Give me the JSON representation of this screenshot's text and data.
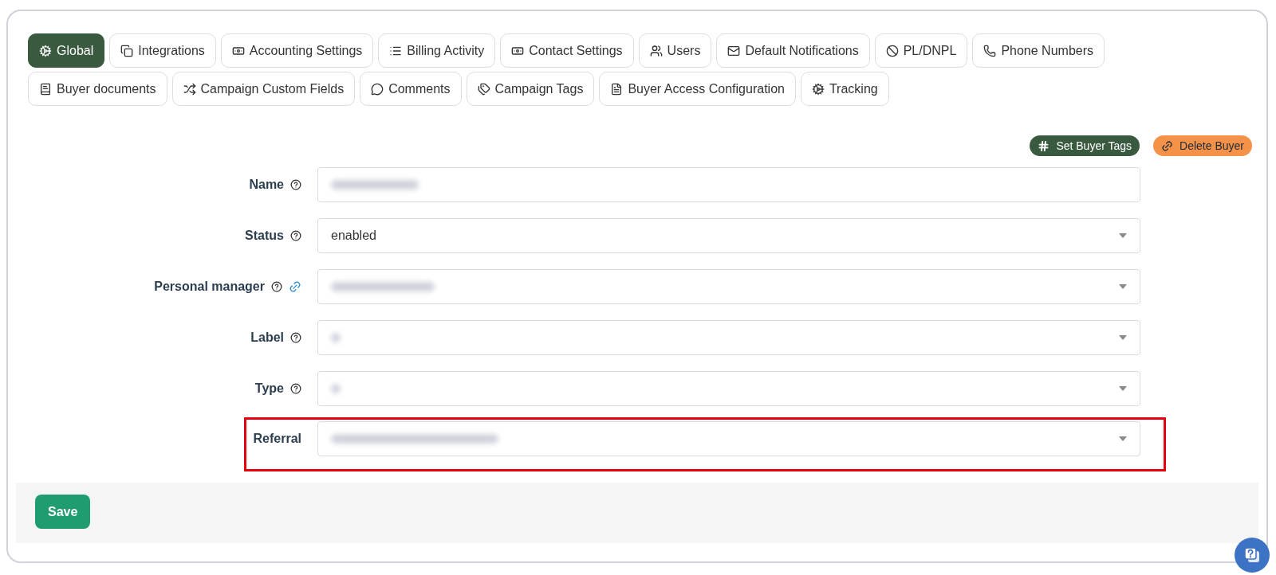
{
  "tabs": [
    {
      "label": "Global",
      "selected": true
    },
    {
      "label": "Integrations",
      "selected": false
    },
    {
      "label": "Accounting Settings",
      "selected": false
    },
    {
      "label": "Billing Activity",
      "selected": false
    },
    {
      "label": "Contact Settings",
      "selected": false
    },
    {
      "label": "Users",
      "selected": false
    },
    {
      "label": "Default Notifications",
      "selected": false
    },
    {
      "label": "PL/DNPL",
      "selected": false
    },
    {
      "label": "Phone Numbers",
      "selected": false
    },
    {
      "label": "Buyer documents",
      "selected": false
    },
    {
      "label": "Campaign Custom Fields",
      "selected": false
    },
    {
      "label": "Comments",
      "selected": false
    },
    {
      "label": "Campaign Tags",
      "selected": false
    },
    {
      "label": "Buyer Access Configuration",
      "selected": false
    },
    {
      "label": "Tracking",
      "selected": false
    }
  ],
  "actions": [
    {
      "label": "Set Buyer Tags",
      "kind": "tags"
    },
    {
      "label": "Delete Buyer",
      "kind": "delete"
    }
  ],
  "fields": [
    {
      "label": "Name",
      "kind": "text",
      "help": true,
      "link": false,
      "redacted": true,
      "highlighted": false
    },
    {
      "label": "Status",
      "kind": "select",
      "help": true,
      "link": false,
      "value": "enabled",
      "redacted": false,
      "highlighted": false
    },
    {
      "label": "Personal manager",
      "kind": "select",
      "help": true,
      "link": true,
      "redacted": true,
      "highlighted": false
    },
    {
      "label": "Label",
      "kind": "select",
      "help": true,
      "link": false,
      "redacted": true,
      "highlighted": false
    },
    {
      "label": "Type",
      "kind": "select",
      "help": true,
      "link": false,
      "redacted": true,
      "highlighted": false
    },
    {
      "label": "Referral",
      "kind": "select",
      "help": false,
      "link": false,
      "redacted": true,
      "highlighted": true
    }
  ],
  "save_button": "Save"
}
